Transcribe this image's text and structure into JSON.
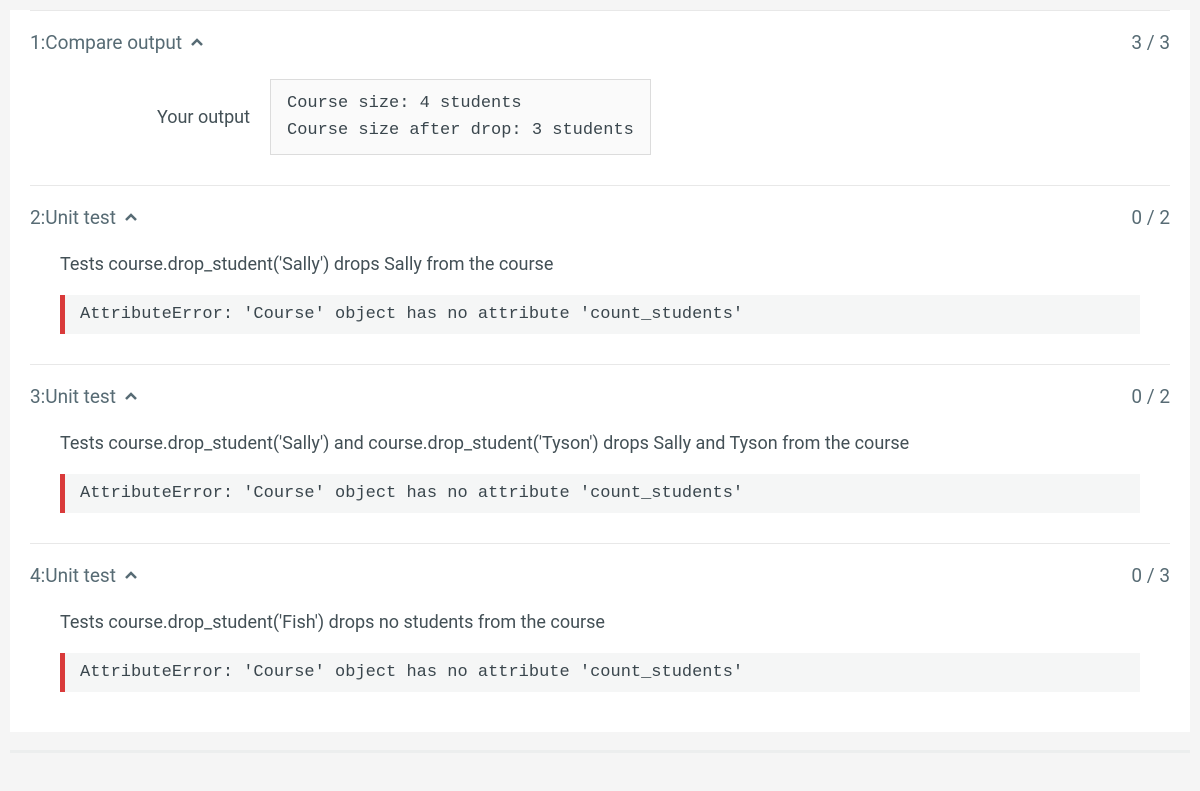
{
  "tests": [
    {
      "title": "1:Compare output",
      "score": "3 / 3",
      "your_output_label": "Your output",
      "output": "Course size: 4 students\nCourse size after drop: 3 students"
    },
    {
      "title": "2:Unit test",
      "score": "0 / 2",
      "description": "Tests course.drop_student('Sally') drops Sally from the course",
      "error": "AttributeError: 'Course' object has no attribute 'count_students'"
    },
    {
      "title": "3:Unit test",
      "score": "0 / 2",
      "description": "Tests course.drop_student('Sally') and course.drop_student('Tyson') drops Sally and Tyson from the course",
      "error": "AttributeError: 'Course' object has no attribute 'count_students'"
    },
    {
      "title": "4:Unit test",
      "score": "0 / 3",
      "description": "Tests course.drop_student('Fish') drops no students from the course",
      "error": "AttributeError: 'Course' object has no attribute 'count_students'"
    }
  ]
}
